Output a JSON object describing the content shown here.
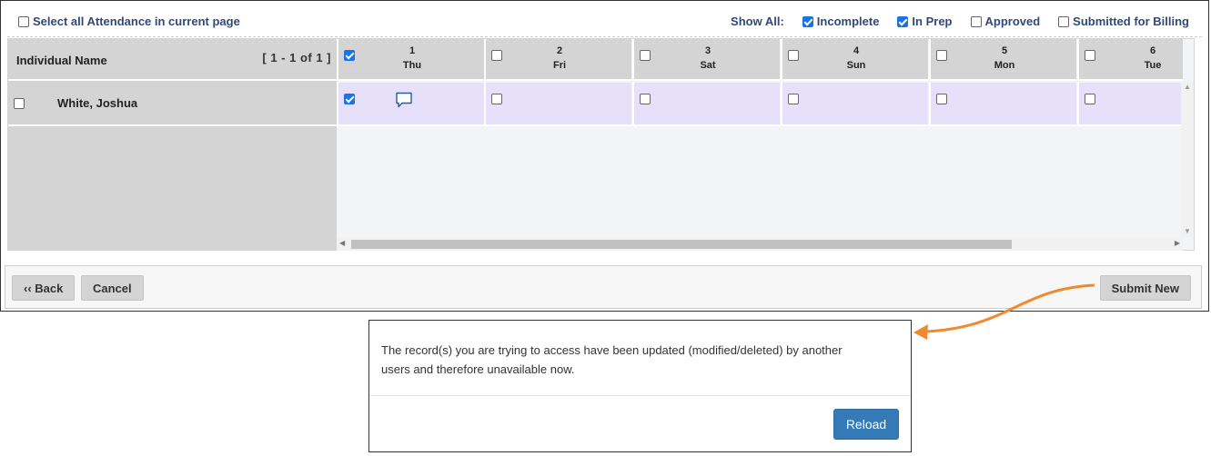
{
  "topbar": {
    "select_all_label": "Select all Attendance in current page",
    "show_all_label": "Show All:",
    "filters": [
      {
        "label": "Incomplete",
        "checked": true
      },
      {
        "label": "In Prep",
        "checked": true
      },
      {
        "label": "Approved",
        "checked": false
      },
      {
        "label": "Submitted for Billing",
        "checked": false
      }
    ]
  },
  "grid": {
    "name_header": "Individual Name",
    "pagination": "[ 1 - 1 of 1 ]",
    "days": [
      {
        "num": "1",
        "dow": "Thu",
        "header_checked": true
      },
      {
        "num": "2",
        "dow": "Fri",
        "header_checked": false
      },
      {
        "num": "3",
        "dow": "Sat",
        "header_checked": false
      },
      {
        "num": "4",
        "dow": "Sun",
        "header_checked": false
      },
      {
        "num": "5",
        "dow": "Mon",
        "header_checked": false
      },
      {
        "num": "6",
        "dow": "Tue",
        "header_checked": false
      }
    ],
    "rows": [
      {
        "name": "White, Joshua",
        "checked": false,
        "cells_checked": [
          true,
          false,
          false,
          false,
          false,
          false
        ],
        "comment_icon_day": 0
      }
    ]
  },
  "buttons": {
    "back": "‹‹ Back",
    "cancel": "Cancel",
    "submit_new": "Submit New"
  },
  "modal": {
    "message_line1": "The record(s) you are trying to access have been updated (modified/deleted) by another",
    "message_line2": "users and therefore unavailable now.",
    "reload": "Reload"
  },
  "colors": {
    "accent": "#2f4a78",
    "checkbox_checked": "#1a73e8",
    "row_highlight": "#e7e0fb",
    "reload_button": "#337ab7",
    "arrow": "#f08a2c"
  }
}
